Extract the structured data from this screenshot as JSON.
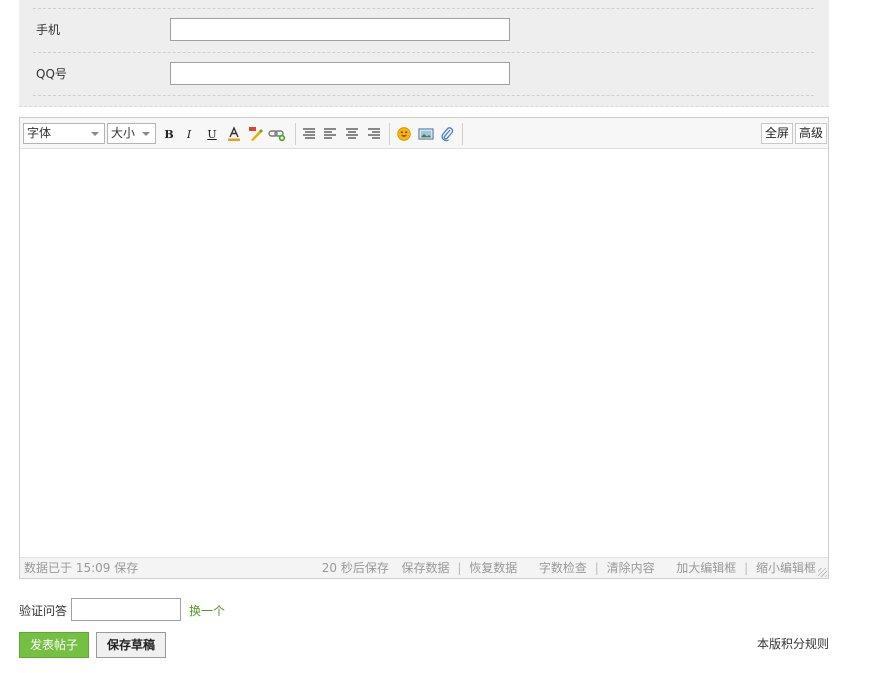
{
  "form": {
    "phone_label": "手机",
    "phone_value": "",
    "qq_label": "QQ号",
    "qq_value": ""
  },
  "toolbar": {
    "font_select": "字体",
    "size_select": "大小",
    "bold_label": "B",
    "italic_label": "I",
    "underline_label": "U",
    "fullscreen_label": "全屏",
    "advanced_label": "高级"
  },
  "statusbar": {
    "saved_status": "数据已于 15:09 保存",
    "autosave_countdown": "20 秒后保存",
    "save_data": "保存数据",
    "restore_data": "恢复数据",
    "word_check": "字数检查",
    "clear_content": "清除内容",
    "enlarge_editor": "加大编辑框",
    "shrink_editor": "缩小编辑框"
  },
  "verify": {
    "label": "验证问答",
    "value": "",
    "change_link": "换一个"
  },
  "actions": {
    "submit_label": "发表帖子",
    "draft_label": "保存草稿",
    "rules_link": "本版积分规则"
  },
  "colors": {
    "submit_green": "#75c044",
    "link_green": "#4e9a1e"
  }
}
